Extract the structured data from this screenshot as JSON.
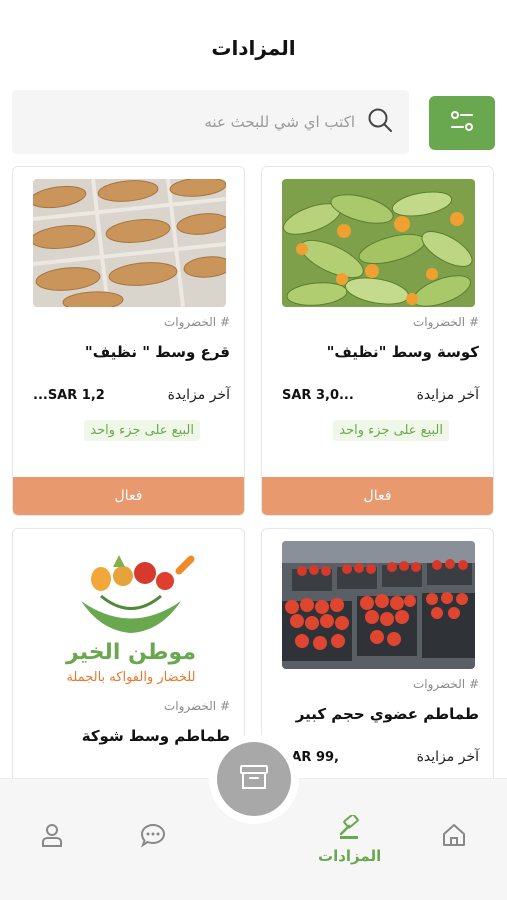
{
  "header": {
    "title": "المزادات"
  },
  "search": {
    "placeholder": "اكتب اي شي للبحث عنه"
  },
  "cards": [
    {
      "category": "# الخضروات",
      "title": "كوسة وسط \"نظيف\"",
      "last_bid_label": "آخر مزايدة",
      "price": "SAR 3,0...",
      "sale_tag": "البيع على جزء واحد",
      "status": "فعال",
      "image": "zucchini-photo"
    },
    {
      "category": "# الخضروات",
      "title": "قرع وسط \" نظيف\"",
      "last_bid_label": "آخر مزايدة",
      "price": "...SAR 1,2",
      "sale_tag": "البيع على جزء واحد",
      "status": "فعال",
      "image": "gourd-photo"
    },
    {
      "category": "# الخضروات",
      "title": "طماطم عضوي حجم كبير",
      "last_bid_label": "آخر مزايدة",
      "price": "SAR 99,",
      "image": "tomatoes-photo"
    },
    {
      "category": "# الخضروات",
      "title": "طماطم وسط شوكة",
      "image": "logo",
      "logo_text_1": "موطن الخير",
      "logo_text_2": "للخضار والفواكه بالجملة"
    }
  ],
  "nav": {
    "auctions_label": "المزادات",
    "icons": [
      "home-icon",
      "gavel-icon",
      "chat-icon",
      "profile-icon",
      "box-icon"
    ]
  },
  "colors": {
    "accent": "#6aa84f",
    "status": "#e8996d",
    "fab": "#a8a8a8"
  }
}
